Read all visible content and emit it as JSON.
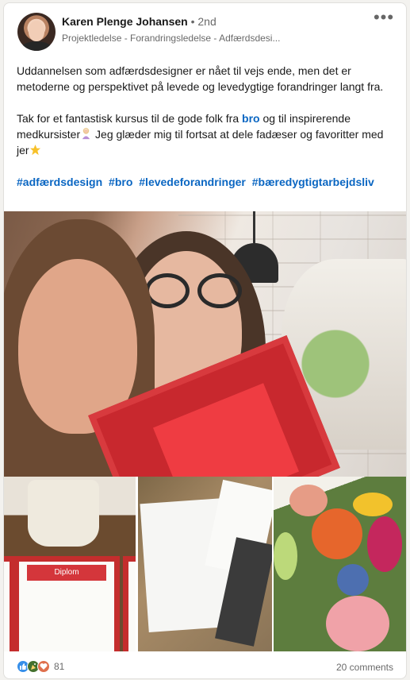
{
  "author": {
    "name": "Karen Plenge Johansen",
    "degree": "• 2nd",
    "headline": "Projektledelse - Forandringsledelse - Adfærdsdesi..."
  },
  "post": {
    "paragraph1": "Uddannelsen som adfærdsdesigner er nået til vejs ende, men det er metoderne og perspektivet på levede og levedygtige forandringer langt fra.",
    "paragraph2_before": "Tak for et fantastisk kursus til de gode folk fra ",
    "paragraph2_link": "bro",
    "paragraph2_mid": " og til inspirerende medkursister",
    "paragraph2_after": " Jeg glæder mig til fortsat at dele fadæser og favoritter med jer",
    "hashtags": [
      "#adfærdsdesign",
      "#bro",
      "#levedeforandringer",
      "#bæredygtigtarbejdsliv"
    ]
  },
  "images": {
    "diploma_heading": "Diplom"
  },
  "social": {
    "reaction_count": "81",
    "comments": "20 comments"
  },
  "icons": [
    "more-options-icon",
    "woman-emoji-icon",
    "star-emoji-icon",
    "like-reaction-icon",
    "celebrate-reaction-icon",
    "love-reaction-icon"
  ],
  "colors": {
    "link": "#0a66c2",
    "like": "#378fe9",
    "celebrate": "#44712e",
    "love": "#df704d"
  }
}
